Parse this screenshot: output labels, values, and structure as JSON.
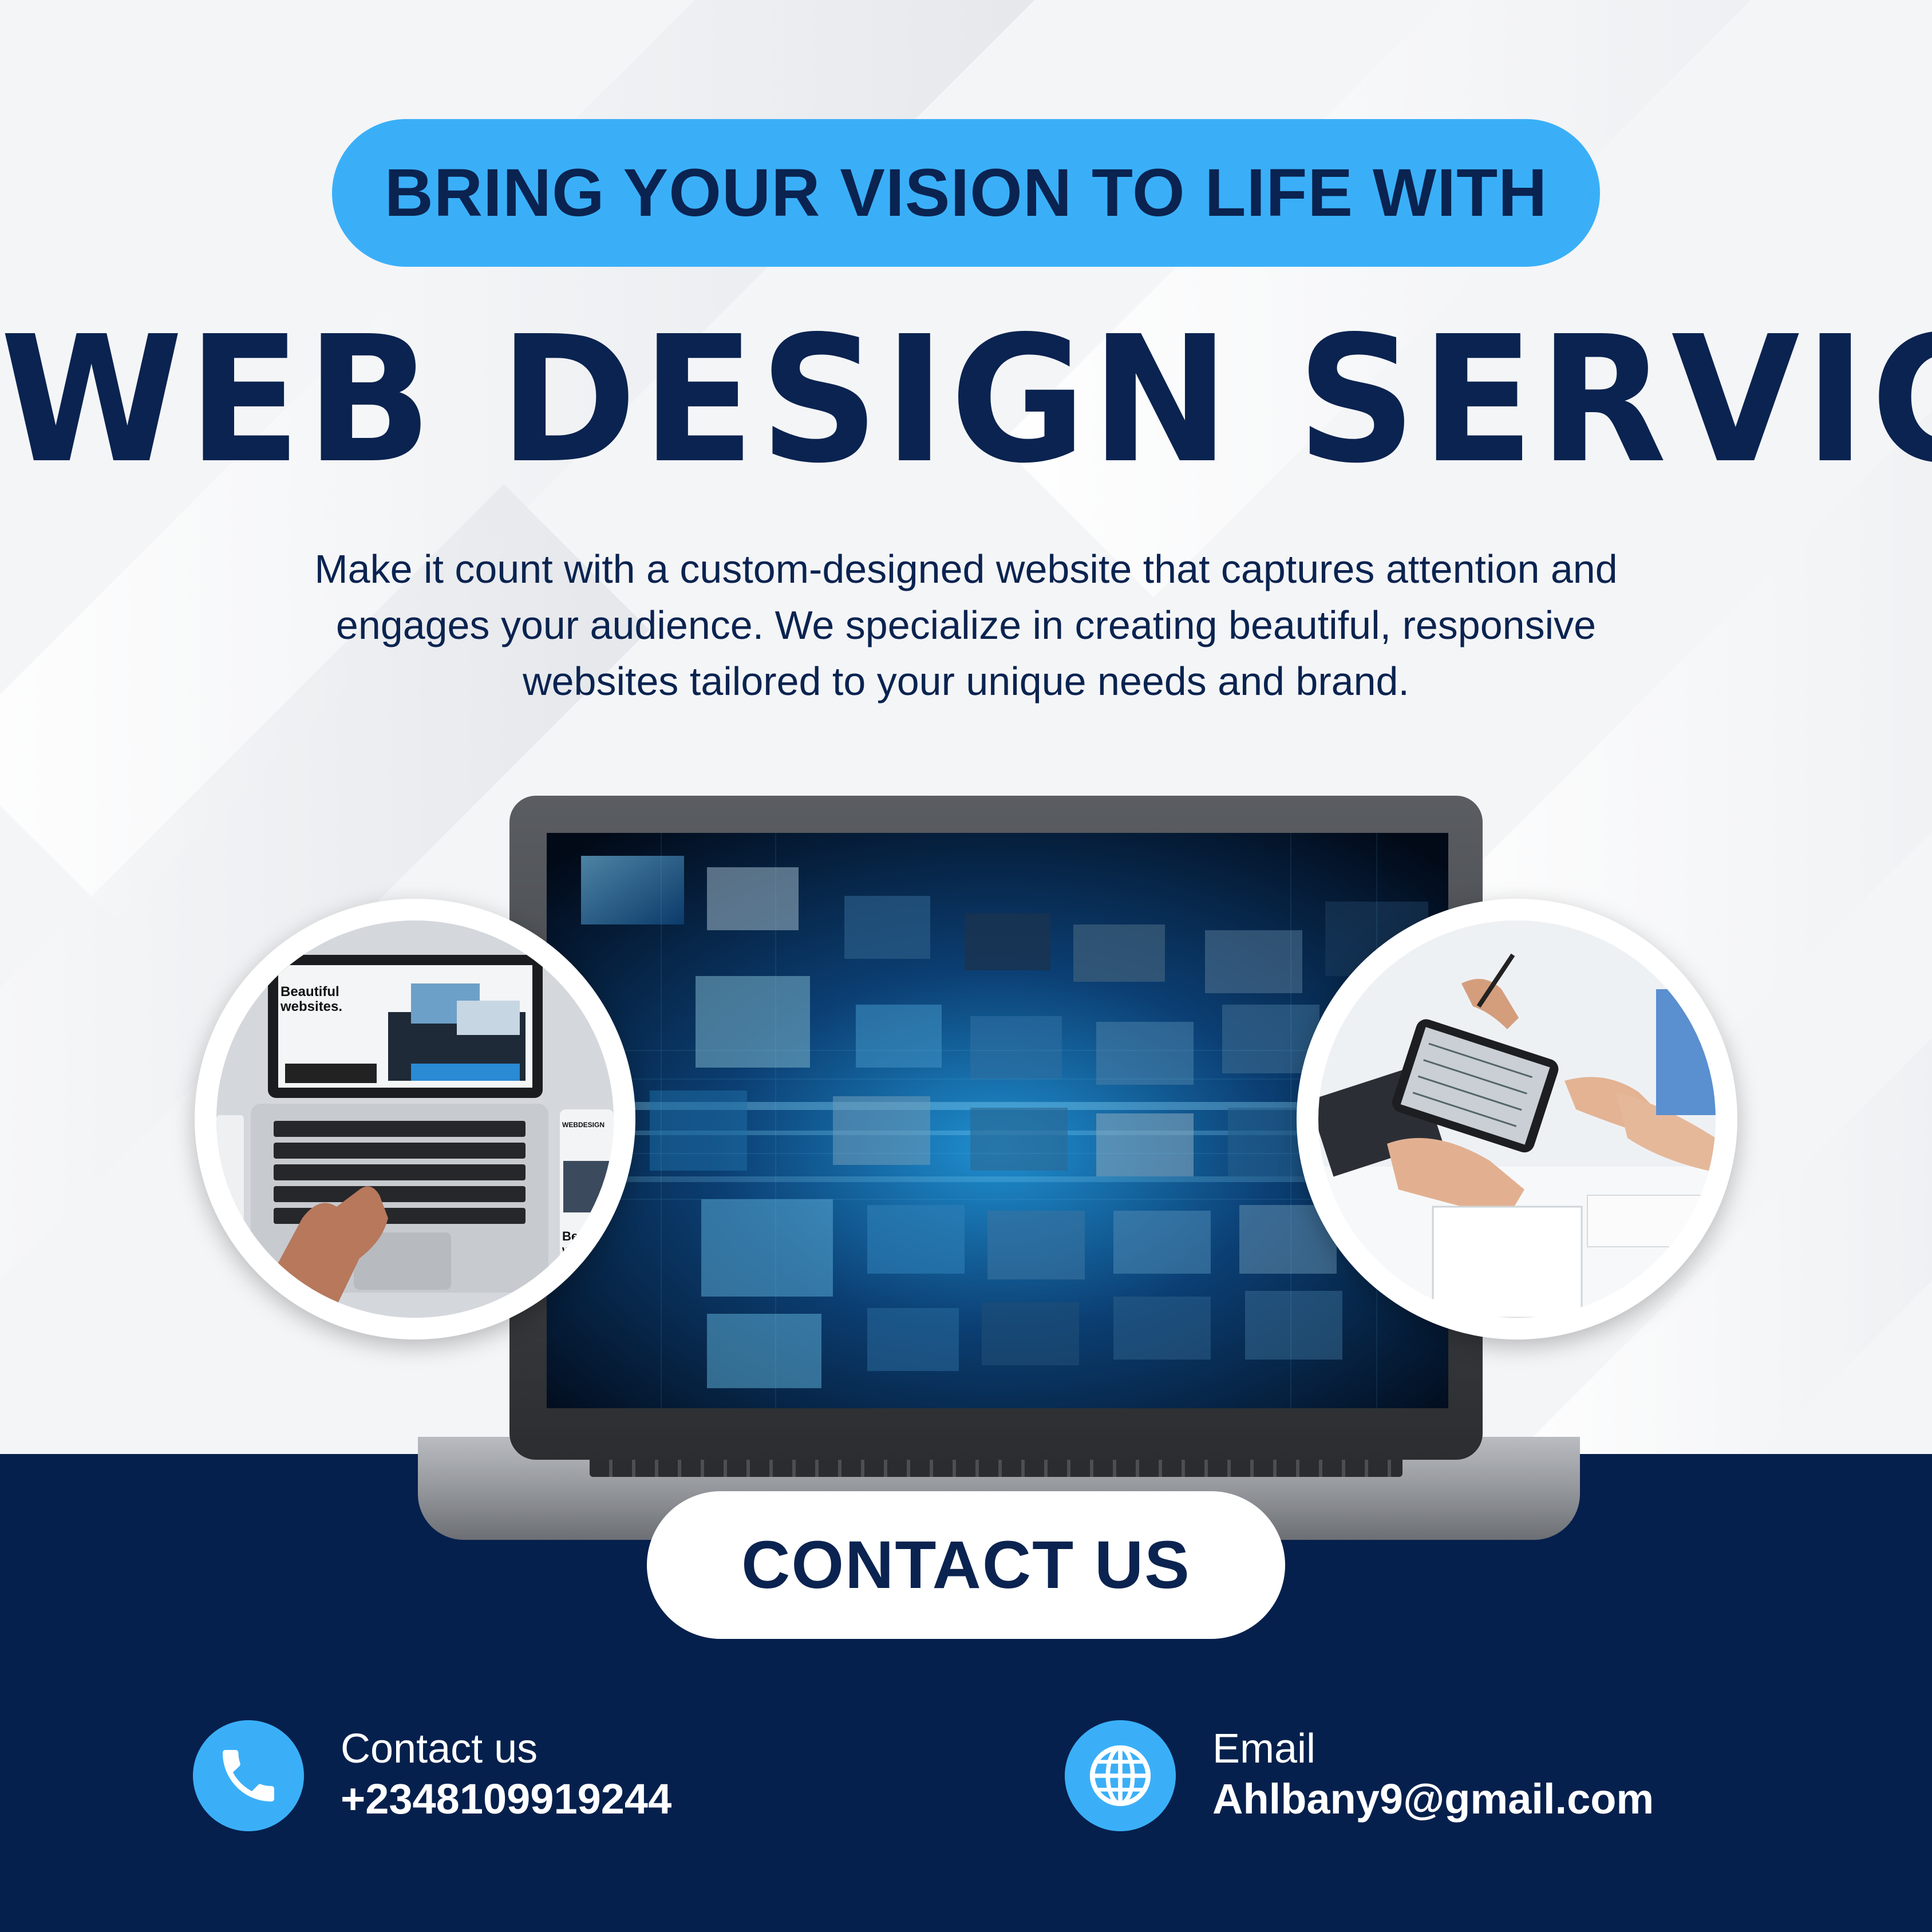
{
  "header": {
    "tagline": "BRING YOUR VISION TO LIFE WITH",
    "title": "WEB DESIGN SERVICE",
    "description": "Make it count with a custom-designed website that captures attention and engages your audience. We specialize in creating beautiful, responsive websites tailored to your unique needs and brand."
  },
  "images": {
    "left_circle": {
      "screen_heading": "Beautiful websites.",
      "tablet_brand": "WEBDESIGN",
      "tablet_heading": "Bea wel"
    }
  },
  "cta": {
    "label": "CONTACT US"
  },
  "contacts": [
    {
      "label": "Contact us",
      "value": "+2348109919244",
      "icon": "phone-icon"
    },
    {
      "label": "Email",
      "value": "Ahlbany9@gmail.com",
      "icon": "globe-icon"
    }
  ],
  "colors": {
    "navy": "#06204d",
    "text_navy": "#0a2350",
    "accent_blue": "#3aaff8",
    "white": "#ffffff",
    "background": "#f4f5f7"
  }
}
